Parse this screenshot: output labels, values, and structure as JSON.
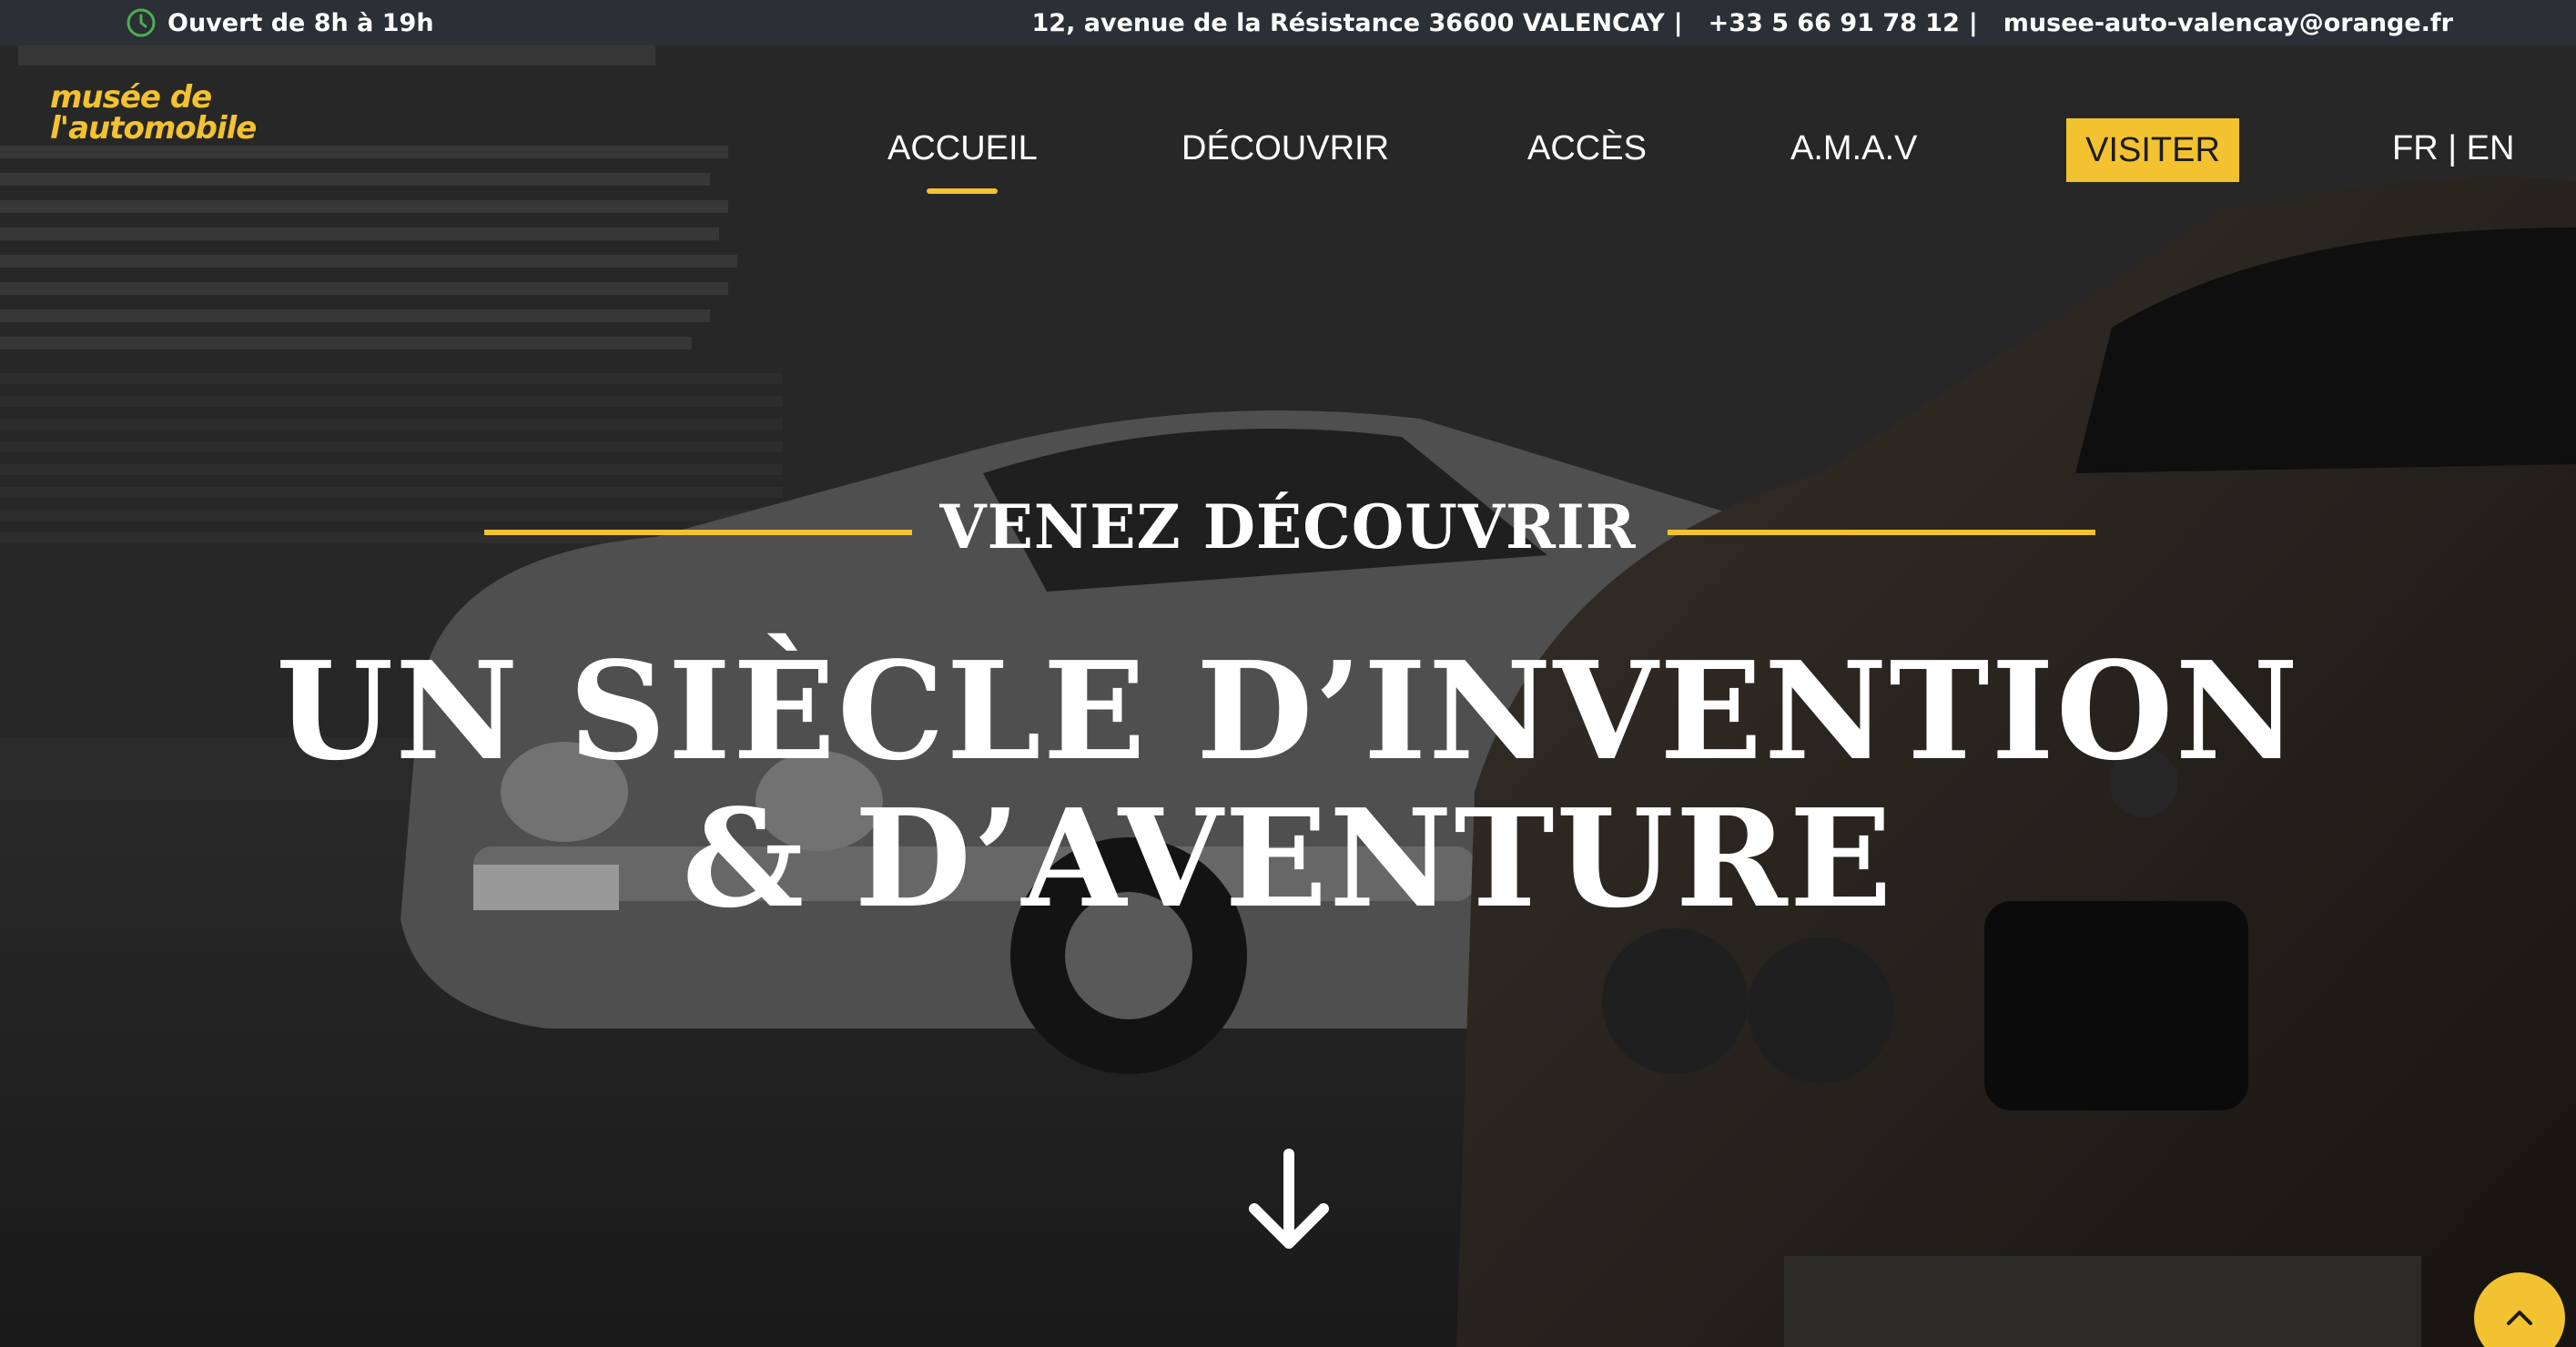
{
  "topbar": {
    "hours": "Ouvert de 8h à 19h",
    "address": "12, avenue de la Résistance 36600 VALENCAY",
    "phone": "+33 5 66 91 78 12",
    "email": "musee-auto-valencay@orange.fr",
    "separator": "|",
    "icon": "clock-icon"
  },
  "logo": {
    "line1": "musée de",
    "line2": "l'automobile"
  },
  "nav": {
    "items": [
      {
        "label": "ACCUEIL",
        "active": true
      },
      {
        "label": "DÉCOUVRIR",
        "active": false
      },
      {
        "label": "ACCÈS",
        "active": false
      },
      {
        "label": "A.M.A.V",
        "active": false
      }
    ],
    "cta": "VISITER",
    "lang": "FR | EN"
  },
  "hero": {
    "eyebrow": "VENEZ DÉCOUVRIR",
    "headline_line1": "UN SIÈCLE D’INVENTION",
    "headline_line2": "& D’AVENTURE",
    "scroll_icon": "arrow-down-icon"
  },
  "back_to_top": {
    "icon": "chevron-up-icon"
  },
  "colors": {
    "accent": "#f2c230",
    "topbar": "#2b2f36",
    "text": "#ffffff"
  }
}
